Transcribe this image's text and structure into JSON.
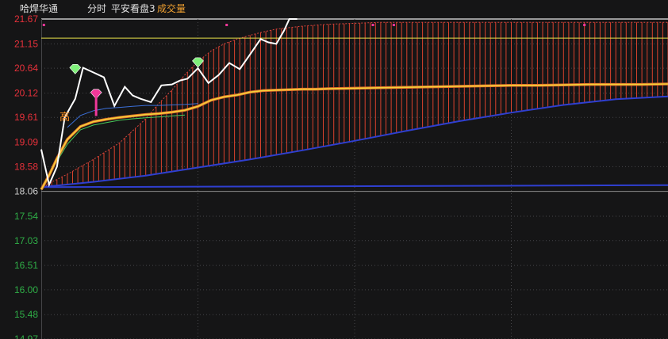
{
  "header": {
    "stock_name": "哈焊华通",
    "mode": "分时",
    "indicator": "平安看盘3",
    "volume_label": "成交量"
  },
  "colors": {
    "background": "#151516",
    "axis_up": "#e8313b",
    "axis_down": "#2fae47",
    "axis_neutral": "#cfcfcf",
    "price_line": "#ffffff",
    "avg_line": "#f5d23a",
    "ref_line": "#e6e04a",
    "band_bar": "#d9422d",
    "band_lower": "#2f3fd0",
    "band_upper": "#d9433c",
    "grid": "#454548",
    "marker_green": "#7ff07a",
    "marker_pink": "#f0389a",
    "label_high": "#ff9020",
    "inner_green": "#48c85a",
    "inner_blue": "#3b6fd8"
  },
  "chart_data": {
    "type": "line",
    "title": "",
    "xlabel": "",
    "ylabel": "",
    "ylim": [
      14.97,
      21.67
    ],
    "y_ticks": [
      "21.67",
      "21.15",
      "20.64",
      "20.12",
      "19.61",
      "19.09",
      "18.58",
      "18.06",
      "17.54",
      "17.03",
      "16.51",
      "16.00",
      "15.48",
      "14.97"
    ],
    "y_tick_values": [
      21.67,
      21.15,
      20.64,
      20.12,
      19.61,
      19.09,
      18.58,
      18.06,
      17.54,
      17.03,
      16.51,
      16.0,
      15.48,
      14.97
    ],
    "prev_close": 18.06,
    "x_range": [
      0,
      240
    ],
    "grid": true,
    "series": [
      {
        "key": "price",
        "x": [
          0,
          3,
          6,
          9,
          13,
          16,
          20,
          24,
          28,
          32,
          35,
          38,
          42,
          46,
          50,
          53,
          56,
          60,
          64,
          68,
          72,
          76,
          80,
          84,
          87,
          90,
          93,
          95,
          98
        ],
        "values": [
          18.94,
          18.2,
          18.58,
          19.61,
          20.0,
          20.65,
          20.55,
          20.45,
          19.85,
          20.25,
          20.07,
          20.0,
          19.93,
          20.28,
          20.3,
          20.38,
          20.42,
          20.64,
          20.33,
          20.5,
          20.75,
          20.62,
          20.93,
          21.25,
          21.18,
          21.15,
          21.43,
          21.67,
          21.67
        ]
      },
      {
        "key": "average",
        "x": [
          0,
          3,
          6,
          10,
          15,
          20,
          25,
          30,
          35,
          40,
          45,
          50,
          55,
          60,
          65,
          70,
          75,
          80,
          85,
          90,
          95,
          100,
          105,
          110,
          120,
          130,
          140,
          150,
          160,
          170,
          180,
          190,
          200,
          210,
          220,
          230,
          240
        ],
        "values": [
          18.1,
          18.4,
          18.75,
          19.15,
          19.42,
          19.52,
          19.57,
          19.61,
          19.64,
          19.67,
          19.69,
          19.72,
          19.76,
          19.84,
          19.97,
          20.04,
          20.08,
          20.14,
          20.17,
          20.18,
          20.19,
          20.2,
          20.2,
          20.21,
          20.22,
          20.23,
          20.24,
          20.25,
          20.26,
          20.27,
          20.28,
          20.28,
          20.29,
          20.3,
          20.3,
          20.3,
          20.31
        ]
      },
      {
        "key": "inner_green",
        "x": [
          5,
          10,
          15,
          20,
          25,
          30,
          35,
          40,
          45,
          50,
          55
        ],
        "values": [
          18.6,
          19.05,
          19.35,
          19.45,
          19.5,
          19.55,
          19.58,
          19.6,
          19.62,
          19.64,
          19.66
        ]
      },
      {
        "key": "inner_blue",
        "x": [
          10,
          15,
          20,
          25,
          30,
          35,
          40,
          45,
          50,
          55,
          60
        ],
        "values": [
          19.4,
          19.65,
          19.75,
          19.8,
          19.82,
          19.84,
          19.86,
          19.86,
          19.87,
          19.88,
          19.9
        ]
      },
      {
        "key": "band_upper",
        "x": [
          0,
          10,
          20,
          30,
          40,
          45,
          50,
          55,
          60,
          65,
          70,
          75,
          80,
          85,
          90,
          100,
          110,
          120,
          130,
          140,
          160,
          180,
          200,
          220,
          240
        ],
        "values": [
          18.15,
          18.42,
          18.73,
          19.08,
          19.58,
          19.9,
          20.18,
          20.5,
          20.78,
          21.0,
          21.15,
          21.25,
          21.33,
          21.4,
          21.46,
          21.52,
          21.56,
          21.58,
          21.6,
          21.6,
          21.6,
          21.6,
          21.6,
          21.6,
          21.6
        ]
      },
      {
        "key": "band_lower",
        "x": [
          0,
          20,
          40,
          60,
          80,
          100,
          120,
          140,
          160,
          180,
          200,
          220,
          240
        ],
        "values": [
          18.15,
          18.26,
          18.39,
          18.56,
          18.73,
          18.92,
          19.12,
          19.33,
          19.53,
          19.71,
          19.87,
          19.99,
          20.05
        ]
      },
      {
        "key": "baseline",
        "x": [
          0,
          240
        ],
        "values": [
          18.15,
          18.19
        ]
      },
      {
        "key": "ref_line",
        "x": [
          0,
          240
        ],
        "values": [
          21.27,
          21.27
        ]
      }
    ],
    "markers": [
      {
        "type": "diamond",
        "color": "green",
        "x": 13,
        "y": 20.62
      },
      {
        "type": "diamond",
        "color": "pink",
        "x": 21,
        "y": 20.1
      },
      {
        "type": "diamond",
        "color": "green",
        "x": 60,
        "y": 20.76
      },
      {
        "type": "text",
        "text": "高",
        "x": 9,
        "y": 19.63
      }
    ],
    "top_dots_x": [
      1,
      71,
      127,
      135,
      208,
      254
    ],
    "bar_count": 120
  }
}
